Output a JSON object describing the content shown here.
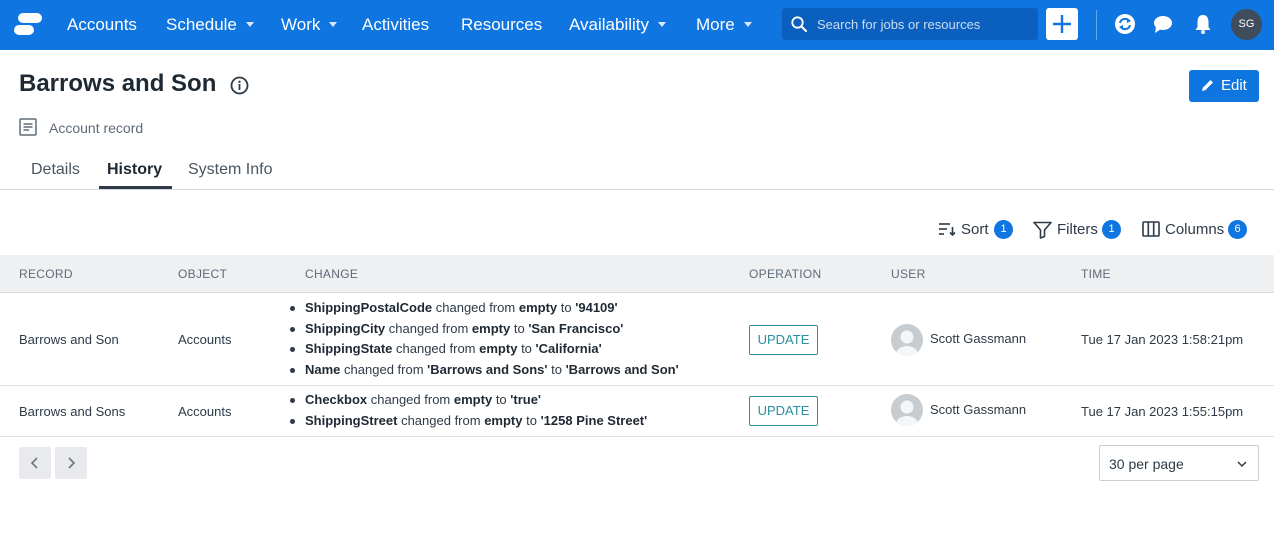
{
  "nav": {
    "items": [
      {
        "label": "Accounts",
        "dropdown": false
      },
      {
        "label": "Schedule",
        "dropdown": true
      },
      {
        "label": "Work",
        "dropdown": true
      },
      {
        "label": "Activities",
        "dropdown": false
      },
      {
        "label": "Resources",
        "dropdown": false
      },
      {
        "label": "Availability",
        "dropdown": true
      },
      {
        "label": "More",
        "dropdown": true
      }
    ],
    "search_placeholder": "Search for jobs or resources",
    "user_initials": "SG",
    "icons": [
      "search-icon",
      "plus-icon",
      "sync-icon",
      "chat-icon",
      "bell-icon"
    ],
    "bar_color": "#0f75e0"
  },
  "header": {
    "title": "Barrows and Son",
    "record_type": "Account record",
    "edit_label": "Edit"
  },
  "tabs": [
    {
      "label": "Details",
      "active": false
    },
    {
      "label": "History",
      "active": true
    },
    {
      "label": "System Info",
      "active": false
    }
  ],
  "toolbar": {
    "sort": {
      "label": "Sort",
      "count": "1"
    },
    "filters": {
      "label": "Filters",
      "count": "1"
    },
    "columns": {
      "label": "Columns",
      "count": "6"
    }
  },
  "table": {
    "columns": [
      "RECORD",
      "OBJECT",
      "CHANGE",
      "OPERATION",
      "USER",
      "TIME"
    ],
    "rows": [
      {
        "record": "Barrows and Son",
        "object": "Accounts",
        "changes": [
          {
            "field": "ShippingPostalCode",
            "from": "empty",
            "to": "'94109'"
          },
          {
            "field": "ShippingCity",
            "from": "empty",
            "to": "'San Francisco'"
          },
          {
            "field": "ShippingState",
            "from": "empty",
            "to": "'California'"
          },
          {
            "field": "Name",
            "from": "'Barrows and Sons'",
            "to": "'Barrows and Son'"
          }
        ],
        "operation": "UPDATE",
        "user": "Scott Gassmann",
        "time": "Tue 17 Jan 2023 1:58:21pm"
      },
      {
        "record": "Barrows and Sons",
        "object": "Accounts",
        "changes": [
          {
            "field": "Checkbox",
            "from": "empty",
            "to": "'true'"
          },
          {
            "field": "ShippingStreet",
            "from": "empty",
            "to": "'1258 Pine Street'"
          }
        ],
        "operation": "UPDATE",
        "user": "Scott Gassmann",
        "time": "Tue 17 Jan 2023 1:55:15pm"
      }
    ],
    "change_words": {
      "changed_from": "changed from",
      "to": "to"
    }
  },
  "pagination": {
    "per_page": "30 per page"
  }
}
